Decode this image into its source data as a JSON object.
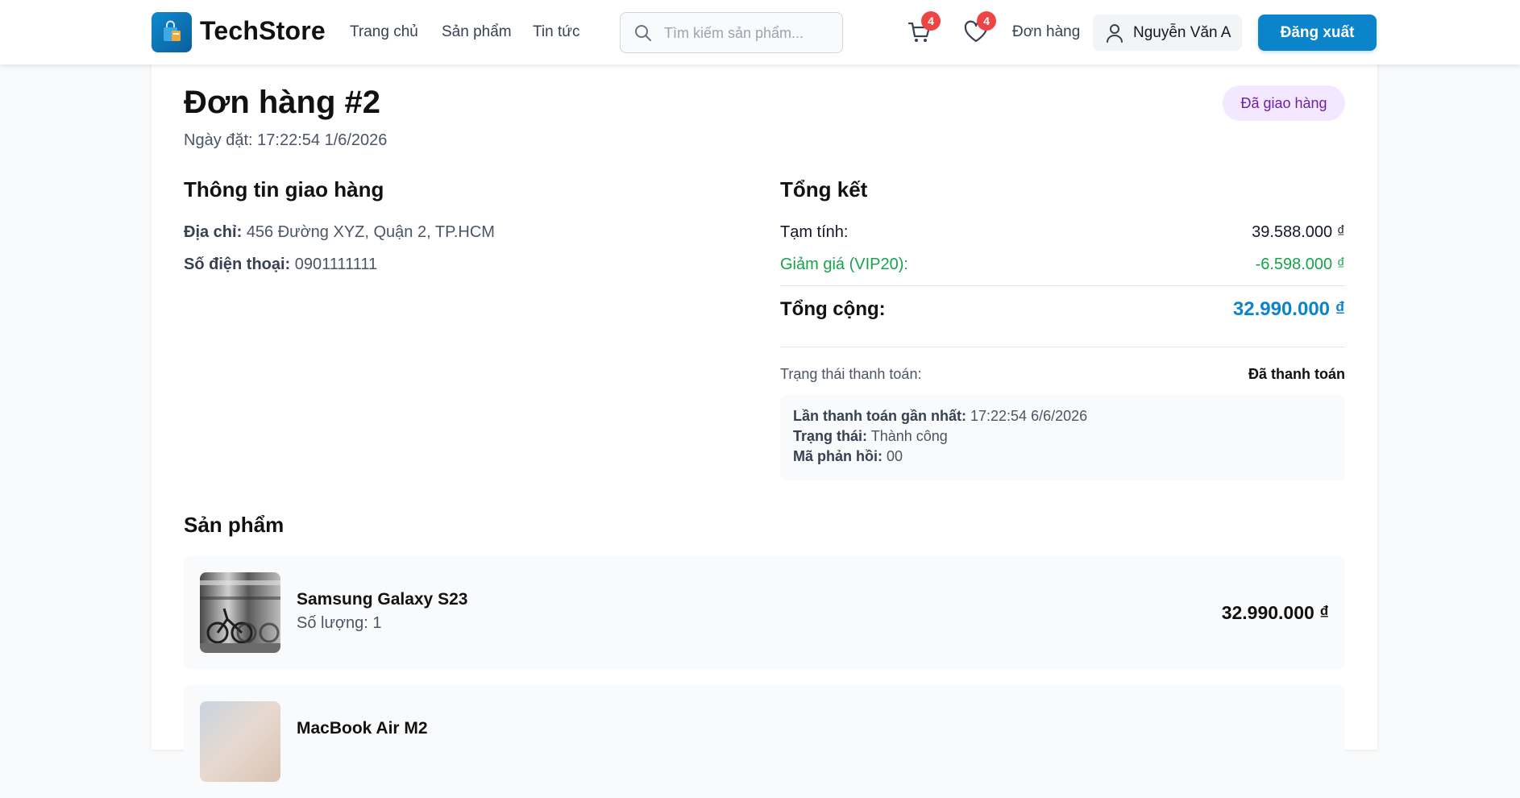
{
  "brand": {
    "name": "TechStore",
    "accent": "#0b84c9"
  },
  "nav": {
    "home": "Trang chủ",
    "products": "Sản phẩm",
    "news": "Tin tức"
  },
  "search": {
    "placeholder": "Tìm kiếm sản phẩm...",
    "value": ""
  },
  "header_actions": {
    "cart_count": "4",
    "wishlist_count": "4",
    "orders": "Đơn hàng",
    "user_name": "Nguyễn Văn A",
    "logout": "Đăng xuất"
  },
  "order": {
    "title": "Đơn hàng #2",
    "date": "Ngày đặt: 17:22:54 1/6/2026",
    "status": "Đã giao hàng"
  },
  "shipping": {
    "title": "Thông tin giao hàng",
    "address_label": "Địa chỉ:",
    "address": "456 Đường XYZ, Quận 2, TP.HCM",
    "phone_label": "Số điện thoại:",
    "phone": "0901111111"
  },
  "summary": {
    "title": "Tổng kết",
    "subtotal_label": "Tạm tính:",
    "subtotal": "39.588.000 ₫",
    "discount_label": "Giảm giá (VIP20):",
    "discount": "-6.598.000 ₫",
    "total_label": "Tổng cộng:",
    "total": "32.990.000 ₫"
  },
  "payment": {
    "status_label": "Trạng thái thanh toán:",
    "status": "Đã thanh toán",
    "last_label": "Lần thanh toán gần nhất:",
    "last": "17:22:54 6/6/2026",
    "state_label": "Trạng thái:",
    "state": "Thành công",
    "code_label": "Mã phản hồi:",
    "code": "00"
  },
  "products": {
    "title": "Sản phẩm",
    "items": [
      {
        "name": "Samsung Galaxy S23",
        "qty": "Số lượng: 1",
        "price": "32.990.000 ₫"
      },
      {
        "name": "MacBook Air M2",
        "qty": "",
        "price": ""
      }
    ]
  }
}
